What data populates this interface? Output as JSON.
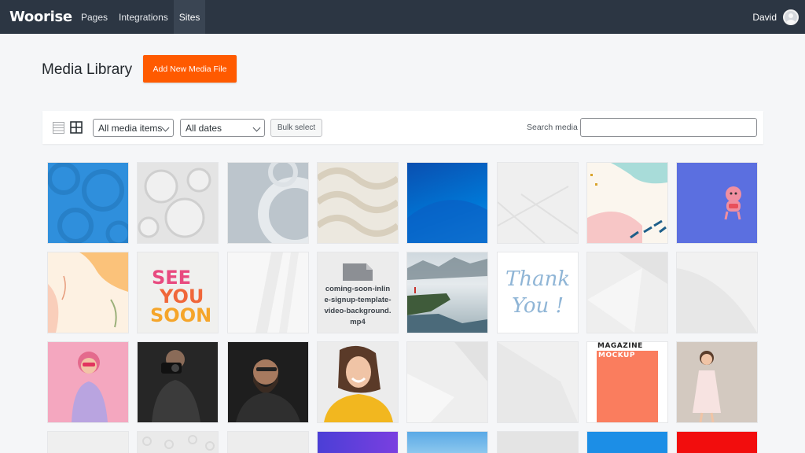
{
  "topbar": {
    "logo": "Woorise",
    "nav": [
      {
        "label": "Pages",
        "active": false
      },
      {
        "label": "Integrations",
        "active": false
      },
      {
        "label": "Sites",
        "active": true
      }
    ],
    "user_name": "David"
  },
  "page": {
    "title": "Media Library",
    "add_button": "Add New Media File"
  },
  "toolbar": {
    "view_list_icon": "list-view-icon",
    "view_grid_icon": "grid-view-icon",
    "filter_type": "All media items",
    "filter_date": "All dates",
    "bulk_select": "Bulk select",
    "search_label": "Search media",
    "search_value": ""
  },
  "colors": {
    "topbar": "#2c3643",
    "accent": "#ff5a00"
  },
  "media": [
    {
      "kind": "image",
      "desc": "blue circles"
    },
    {
      "kind": "image",
      "desc": "white circles"
    },
    {
      "kind": "image",
      "desc": "grey rings"
    },
    {
      "kind": "image",
      "desc": "beige waves"
    },
    {
      "kind": "image",
      "desc": "blue gradient"
    },
    {
      "kind": "image",
      "desc": "light grey lines"
    },
    {
      "kind": "image",
      "desc": "pastel shapes"
    },
    {
      "kind": "image",
      "desc": "purple with character"
    },
    {
      "kind": "image",
      "desc": "peach florals"
    },
    {
      "kind": "image",
      "desc": "see you soon"
    },
    {
      "kind": "image",
      "desc": "white shadows"
    },
    {
      "kind": "file",
      "filename": "coming-soon-inline-signup-template-video-background.mp4"
    },
    {
      "kind": "image",
      "desc": "cliff landscape"
    },
    {
      "kind": "image",
      "desc": "thank you"
    },
    {
      "kind": "image",
      "desc": "white geometric"
    },
    {
      "kind": "image",
      "desc": "white curves"
    },
    {
      "kind": "image",
      "desc": "pink woman"
    },
    {
      "kind": "image",
      "desc": "photographer"
    },
    {
      "kind": "image",
      "desc": "bearded man"
    },
    {
      "kind": "image",
      "desc": "smiling woman"
    },
    {
      "kind": "image",
      "desc": "white lines"
    },
    {
      "kind": "image",
      "desc": "white lines 2"
    },
    {
      "kind": "image",
      "desc": "magazine mockup"
    },
    {
      "kind": "image",
      "desc": "woman in dress"
    },
    {
      "kind": "image",
      "desc": "light grey"
    },
    {
      "kind": "image",
      "desc": "pattern grey"
    },
    {
      "kind": "image",
      "desc": "light grey 2"
    },
    {
      "kind": "image",
      "desc": "purple"
    },
    {
      "kind": "image",
      "desc": "sky blue"
    },
    {
      "kind": "image",
      "desc": "grey bokeh"
    },
    {
      "kind": "image",
      "desc": "blue"
    },
    {
      "kind": "image",
      "desc": "red"
    }
  ],
  "magazine": {
    "line1": "MAGAZINE",
    "line2": "MOCKUP"
  },
  "see_you_soon": {
    "line1": "SEE",
    "line2": "YOU",
    "line3": "SOON"
  },
  "thank_you": {
    "line1": "Thank",
    "line2": "You !"
  }
}
